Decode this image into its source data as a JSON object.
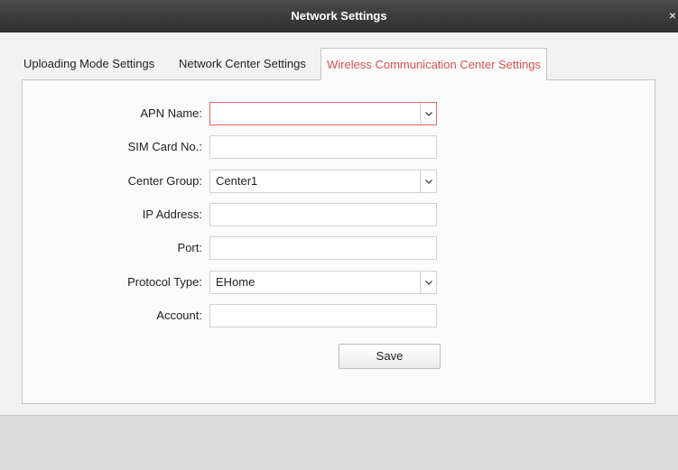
{
  "window": {
    "title": "Network Settings"
  },
  "tabs": [
    {
      "label": "Uploading Mode Settings"
    },
    {
      "label": "Network Center Settings"
    },
    {
      "label": "Wireless Communication Center Settings"
    }
  ],
  "form": {
    "apn_name": {
      "label": "APN Name:",
      "value": ""
    },
    "sim_card_no": {
      "label": "SIM Card No.:",
      "value": ""
    },
    "center_group": {
      "label": "Center Group:",
      "value": "Center1"
    },
    "ip_address": {
      "label": "IP Address:",
      "value": ""
    },
    "port": {
      "label": "Port:",
      "value": ""
    },
    "protocol_type": {
      "label": "Protocol Type:",
      "value": "EHome"
    },
    "account": {
      "label": "Account:",
      "value": ""
    },
    "save_label": "Save"
  },
  "colors": {
    "active_tab": "#d9534f",
    "focus_border": "#e06a67",
    "titlebar": "#3a3a3a"
  }
}
